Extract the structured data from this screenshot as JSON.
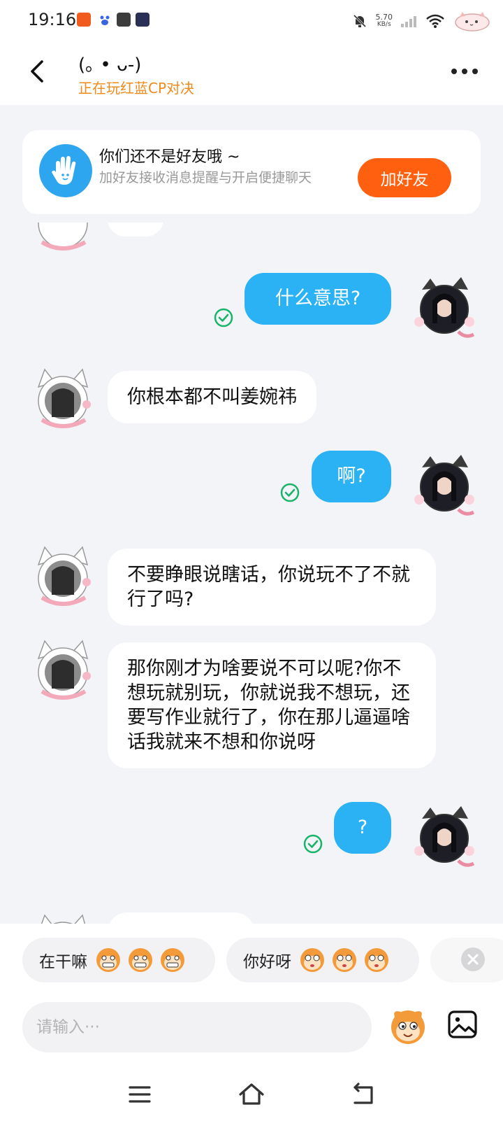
{
  "status_bar": {
    "time": "19:16",
    "net_speed_value": "5.70",
    "net_speed_unit": "KB/s"
  },
  "header": {
    "title": "(｡ • ᴗ-)",
    "subtitle": "正在玩红蓝CP对决"
  },
  "banner": {
    "title": "你们还不是好友哦 ~",
    "description": "加好友接收消息提醒与开启便捷聊天",
    "button_label": "加好友"
  },
  "messages": [
    {
      "sender": "self",
      "text": "什么意思?",
      "read": true
    },
    {
      "sender": "other",
      "text": "你根本都不叫姜婉祎"
    },
    {
      "sender": "self",
      "text": "啊?",
      "read": true
    },
    {
      "sender": "other",
      "text": "不要睁眼说瞎话，你说玩不了不就行了吗?"
    },
    {
      "sender": "other",
      "text": "那你刚才为啥要说不可以呢?你不想玩就别玩，你就说我不想玩，还要写作业就行了，你在那儿逼逼啥话我就来不想和你说呀"
    },
    {
      "sender": "self",
      "text": "?",
      "read": true
    }
  ],
  "quick_replies": [
    {
      "text": "在干嘛"
    },
    {
      "text": "你好呀"
    }
  ],
  "input": {
    "placeholder": "请输入···"
  },
  "colors": {
    "accent_orange": "#ff6010",
    "bubble_blue": "#2ab2f4",
    "subtitle_orange": "#f08a1c",
    "read_green": "#19b36a"
  }
}
